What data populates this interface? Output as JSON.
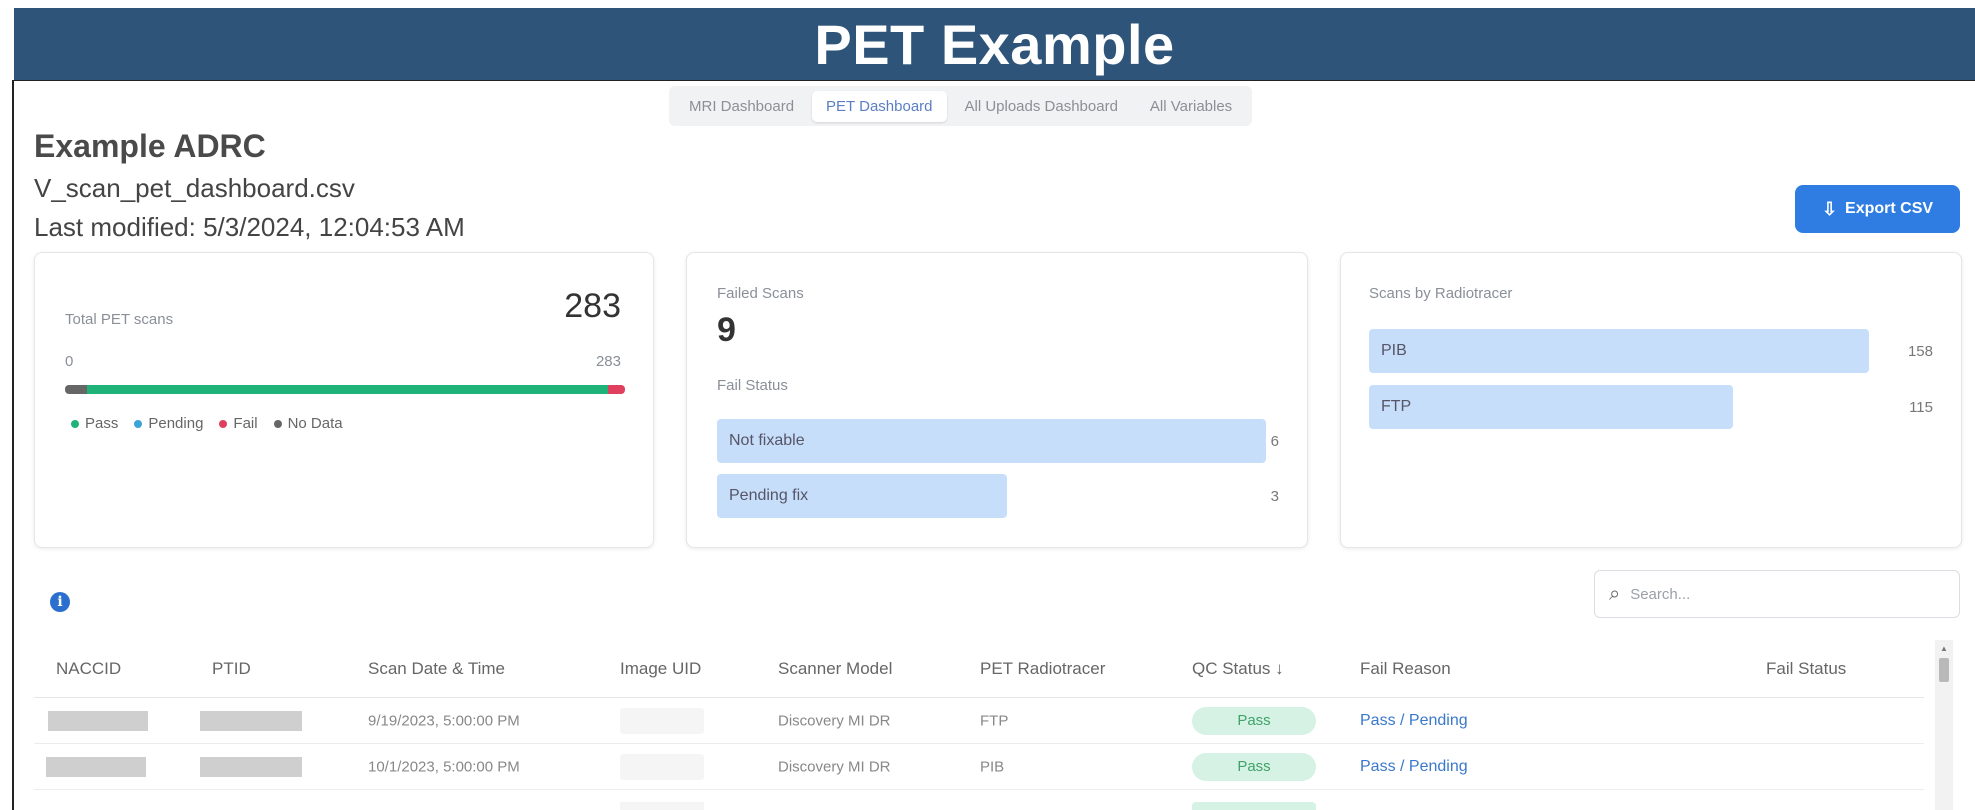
{
  "banner": {
    "title": "PET Example"
  },
  "tabs": [
    {
      "label": "MRI Dashboard"
    },
    {
      "label": "PET Dashboard"
    },
    {
      "label": "All Uploads Dashboard"
    },
    {
      "label": "All Variables"
    }
  ],
  "active_tab": "PET Dashboard",
  "header": {
    "org": "Example ADRC",
    "file": "V_scan_pet_dashboard.csv",
    "modified": "Last modified: 5/3/2024, 12:04:53 AM"
  },
  "export_button": {
    "label": "Export CSV",
    "icon": "export-icon"
  },
  "total_card": {
    "label": "Total PET scans",
    "value": "283",
    "range_min": "0",
    "range_max": "283",
    "segments": [
      {
        "name": "No Data",
        "fraction": 0.04,
        "color": "#666666"
      },
      {
        "name": "Pass",
        "fraction": 0.93,
        "color": "#1fb37a"
      },
      {
        "name": "Fail",
        "fraction": 0.03,
        "color": "#e0405e"
      }
    ],
    "legend": [
      {
        "label": "Pass",
        "color": "#1fb37a"
      },
      {
        "label": "Pending",
        "color": "#3aa3d9"
      },
      {
        "label": "Fail",
        "color": "#e0405e"
      },
      {
        "label": "No Data",
        "color": "#666666"
      }
    ]
  },
  "failed_card": {
    "label": "Failed Scans",
    "value": "9",
    "status_label": "Fail Status",
    "bars": [
      {
        "label": "Not fixable",
        "value": "6"
      },
      {
        "label": "Pending fix",
        "value": "3"
      }
    ]
  },
  "tracer_card": {
    "label": "Scans by Radiotracer",
    "bars": [
      {
        "label": "PIB",
        "value": "158"
      },
      {
        "label": "FTP",
        "value": "115"
      }
    ]
  },
  "search": {
    "placeholder": "Search..."
  },
  "table": {
    "columns": {
      "naccid": "NACCID",
      "ptid": "PTID",
      "scan_date": "Scan Date & Time",
      "image_uid": "Image UID",
      "scanner": "Scanner Model",
      "tracer": "PET Radiotracer",
      "qc": "QC Status ↓",
      "fail_reason": "Fail Reason",
      "fail_status": "Fail Status"
    },
    "rows": [
      {
        "scan_date": "9/19/2023, 5:00:00 PM",
        "scanner": "Discovery MI DR",
        "tracer": "FTP",
        "qc": "Pass",
        "fail_reason": "Pass / Pending"
      },
      {
        "scan_date": "10/1/2023, 5:00:00 PM",
        "scanner": "Discovery MI DR",
        "tracer": "PIB",
        "qc": "Pass",
        "fail_reason": "Pass / Pending"
      }
    ]
  }
}
